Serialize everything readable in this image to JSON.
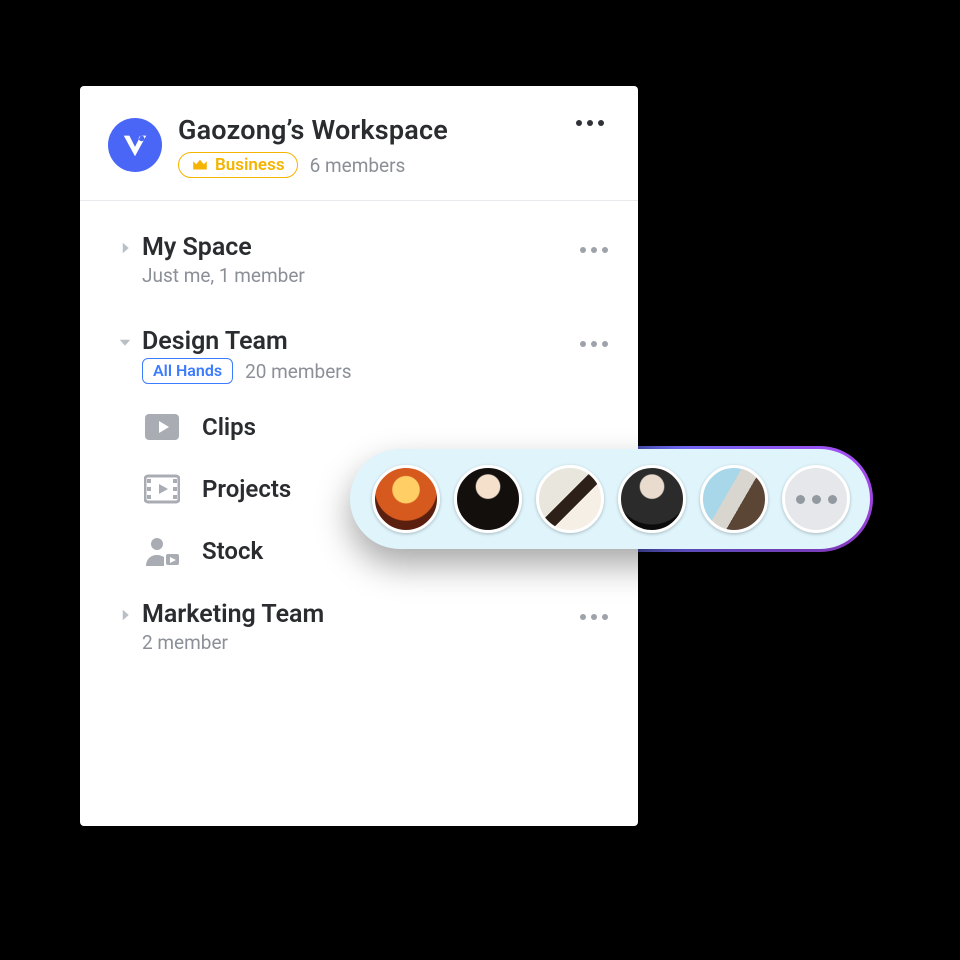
{
  "workspace": {
    "title": "Gaozong’s Workspace",
    "plan": "Business",
    "members": "6 members"
  },
  "spaces": [
    {
      "title": "My Space",
      "meta": "Just me, 1 member",
      "expanded": false,
      "tag": null
    },
    {
      "title": "Design Team",
      "meta": "20 members",
      "expanded": true,
      "tag": "All Hands",
      "children": [
        {
          "label": "Clips",
          "icon": "play"
        },
        {
          "label": "Projects",
          "icon": "film"
        },
        {
          "label": "Stock",
          "icon": "person-play"
        }
      ]
    },
    {
      "title": "Marketing Team",
      "meta": "2 member",
      "expanded": false,
      "tag": null
    }
  ],
  "avatar_overflow": true
}
